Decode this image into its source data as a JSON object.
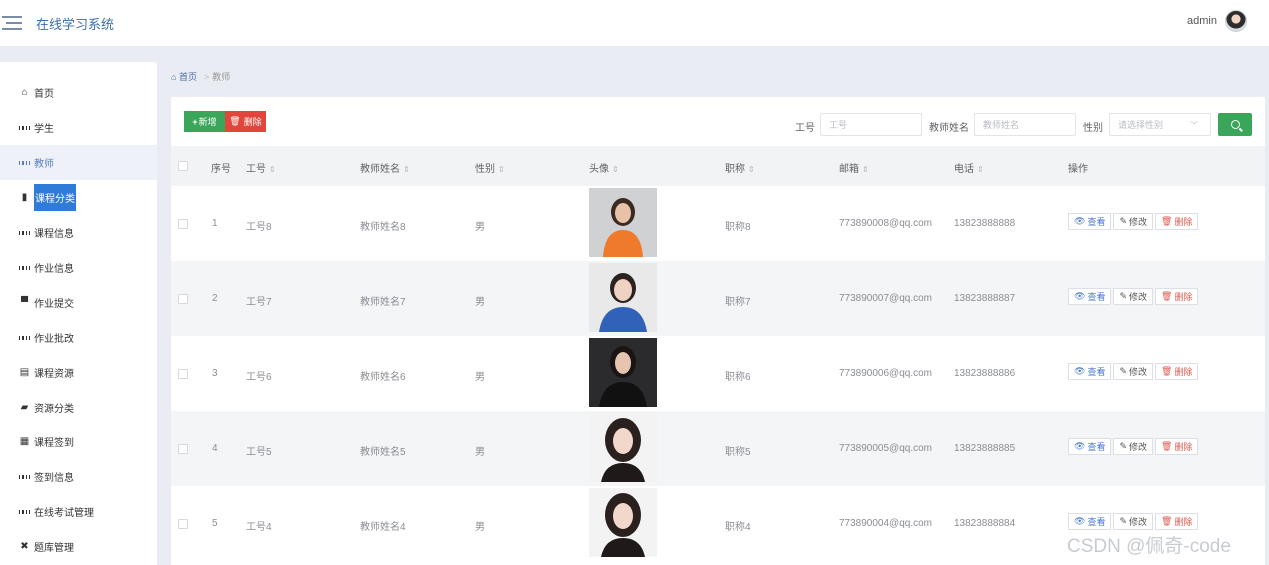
{
  "header": {
    "title": "在线学习系统",
    "username": "admin"
  },
  "sidebar": {
    "items": [
      {
        "label": "首页",
        "icon": "home-icon"
      },
      {
        "label": "学生",
        "icon": "grid-icon"
      },
      {
        "label": "教师",
        "icon": "grid-icon",
        "active": true
      },
      {
        "label": "课程分类",
        "icon": "books-icon",
        "highlighted": true
      },
      {
        "label": "课程信息",
        "icon": "grid-icon"
      },
      {
        "label": "作业信息",
        "icon": "grid-icon"
      },
      {
        "label": "作业提交",
        "icon": "monitor-icon"
      },
      {
        "label": "作业批改",
        "icon": "grid-icon"
      },
      {
        "label": "课程资源",
        "icon": "document-icon"
      },
      {
        "label": "资源分类",
        "icon": "wallet-icon"
      },
      {
        "label": "课程签到",
        "icon": "apps-icon"
      },
      {
        "label": "签到信息",
        "icon": "grid-icon"
      },
      {
        "label": "在线考试管理",
        "icon": "grid-icon"
      },
      {
        "label": "题库管理",
        "icon": "tools-icon"
      }
    ]
  },
  "breadcrumb": {
    "home": "首页",
    "separator": ">",
    "current": "教师"
  },
  "toolbar": {
    "add_label": "新增",
    "delete_label": "删除"
  },
  "search": {
    "id_label": "工号",
    "id_placeholder": "工号",
    "name_label": "教师姓名",
    "name_placeholder": "教师姓名",
    "gender_label": "性别",
    "gender_placeholder": "请选择性别"
  },
  "table": {
    "columns": [
      "序号",
      "工号",
      "教师姓名",
      "性别",
      "头像",
      "职称",
      "邮箱",
      "电话",
      "操作"
    ],
    "actions": {
      "view": "查看",
      "edit": "修改",
      "delete": "删除"
    },
    "rows": [
      {
        "index": "1",
        "id": "工号8",
        "name": "教师姓名8",
        "gender": "男",
        "title": "职称8",
        "email": "773890008@qq.com",
        "phone": "13823888888"
      },
      {
        "index": "2",
        "id": "工号7",
        "name": "教师姓名7",
        "gender": "男",
        "title": "职称7",
        "email": "773890007@qq.com",
        "phone": "13823888887"
      },
      {
        "index": "3",
        "id": "工号6",
        "name": "教师姓名6",
        "gender": "男",
        "title": "职称6",
        "email": "773890006@qq.com",
        "phone": "13823888886"
      },
      {
        "index": "4",
        "id": "工号5",
        "name": "教师姓名5",
        "gender": "男",
        "title": "职称5",
        "email": "773890005@qq.com",
        "phone": "13823888885"
      },
      {
        "index": "5",
        "id": "工号4",
        "name": "教师姓名4",
        "gender": "男",
        "title": "职称4",
        "email": "773890004@qq.com",
        "phone": "13823888884"
      }
    ]
  },
  "watermark": "CSDN @佩奇-code",
  "colors": {
    "primary": "#3aa65a",
    "danger": "#e0463b",
    "accent": "#2f7bd8",
    "link": "#4a78d0"
  }
}
